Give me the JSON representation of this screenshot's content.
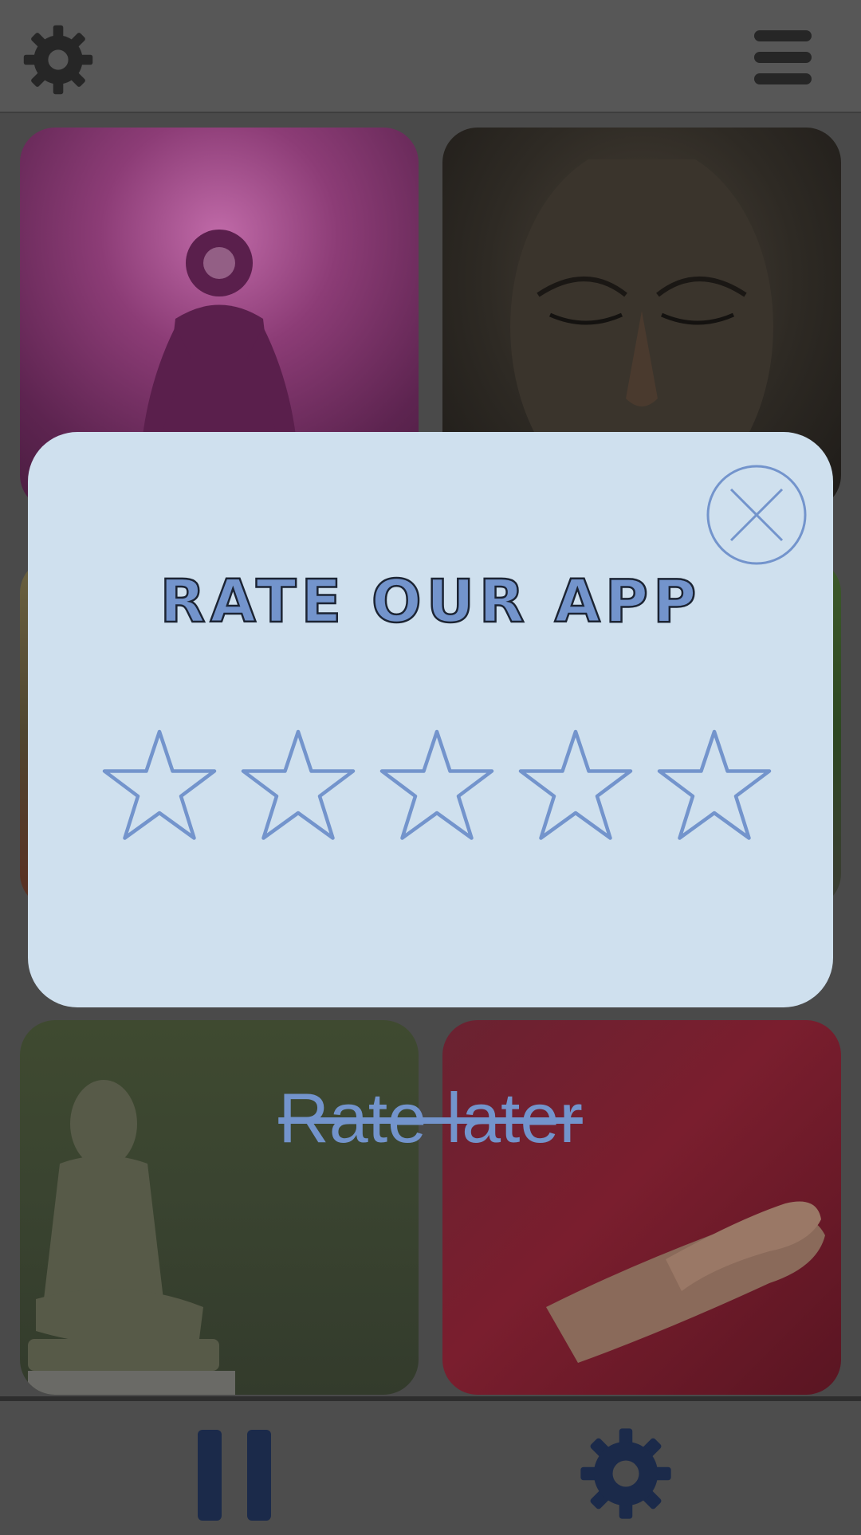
{
  "header": {
    "settings_icon": "gear-icon",
    "menu_icon": "hamburger-menu-icon"
  },
  "grid": {
    "tiles": [
      {
        "name": "meditation-aura"
      },
      {
        "name": "buddha-face"
      },
      {
        "name": "golden-sunset"
      },
      {
        "name": "green-forest"
      },
      {
        "name": "stone-buddha-statue"
      },
      {
        "name": "monk-hands"
      }
    ]
  },
  "dialog": {
    "title": "RATE OUR APP",
    "close_icon": "close-circle-icon",
    "rating": {
      "value": 0,
      "max": 5
    },
    "rate_later_label": "Rate later"
  },
  "footer": {
    "pause_icon": "pause-icon",
    "settings_icon": "gear-icon"
  },
  "colors": {
    "accent": "#7394cc",
    "dialog_bg": "#cfe0ee",
    "overlay_bg": "#4a4a4a",
    "footer_icon": "#1b2a4a"
  }
}
